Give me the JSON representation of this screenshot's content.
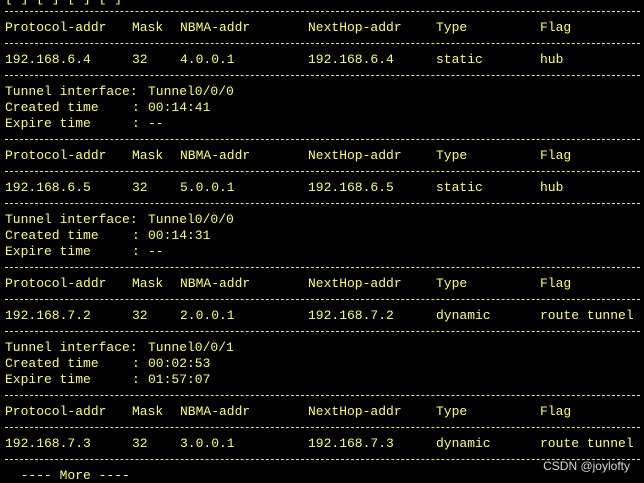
{
  "terminal": {
    "top_partial_line": "[ ] [ ] [ ] [ ]",
    "header": {
      "protocol_addr": "Protocol-addr",
      "mask": "Mask",
      "nbma_addr": "NBMA-addr",
      "nexthop_addr": "NextHop-addr",
      "type": "Type",
      "flag": "Flag"
    },
    "labels": {
      "tunnel_interface": "Tunnel interface:",
      "created_time": "Created time",
      "expire_time": "Expire time",
      "colon": ":"
    },
    "entries": [
      {
        "protocol_addr": "192.168.6.4",
        "mask": "32",
        "nbma_addr": "4.0.0.1",
        "nexthop_addr": "192.168.6.4",
        "type": "static",
        "flag": "hub",
        "tunnel_interface": "Tunnel0/0/0",
        "created_time": "00:14:41",
        "expire_time": "--"
      },
      {
        "protocol_addr": "192.168.6.5",
        "mask": "32",
        "nbma_addr": "5.0.0.1",
        "nexthop_addr": "192.168.6.5",
        "type": "static",
        "flag": "hub",
        "tunnel_interface": "Tunnel0/0/0",
        "created_time": "00:14:31",
        "expire_time": "--"
      },
      {
        "protocol_addr": "192.168.7.2",
        "mask": "32",
        "nbma_addr": "2.0.0.1",
        "nexthop_addr": "192.168.7.2",
        "type": "dynamic",
        "flag": "route tunnel",
        "tunnel_interface": "Tunnel0/0/1",
        "created_time": "00:02:53",
        "expire_time": "01:57:07"
      },
      {
        "protocol_addr": "192.168.7.3",
        "mask": "32",
        "nbma_addr": "3.0.0.1",
        "nexthop_addr": "192.168.7.3",
        "type": "dynamic",
        "flag": "route tunnel"
      }
    ],
    "more_prompt": "  ---- More ----"
  },
  "watermark": "CSDN @joylofty",
  "colors": {
    "background": "#000000",
    "text": "#ffff66",
    "watermark": "#d8d8d8"
  }
}
